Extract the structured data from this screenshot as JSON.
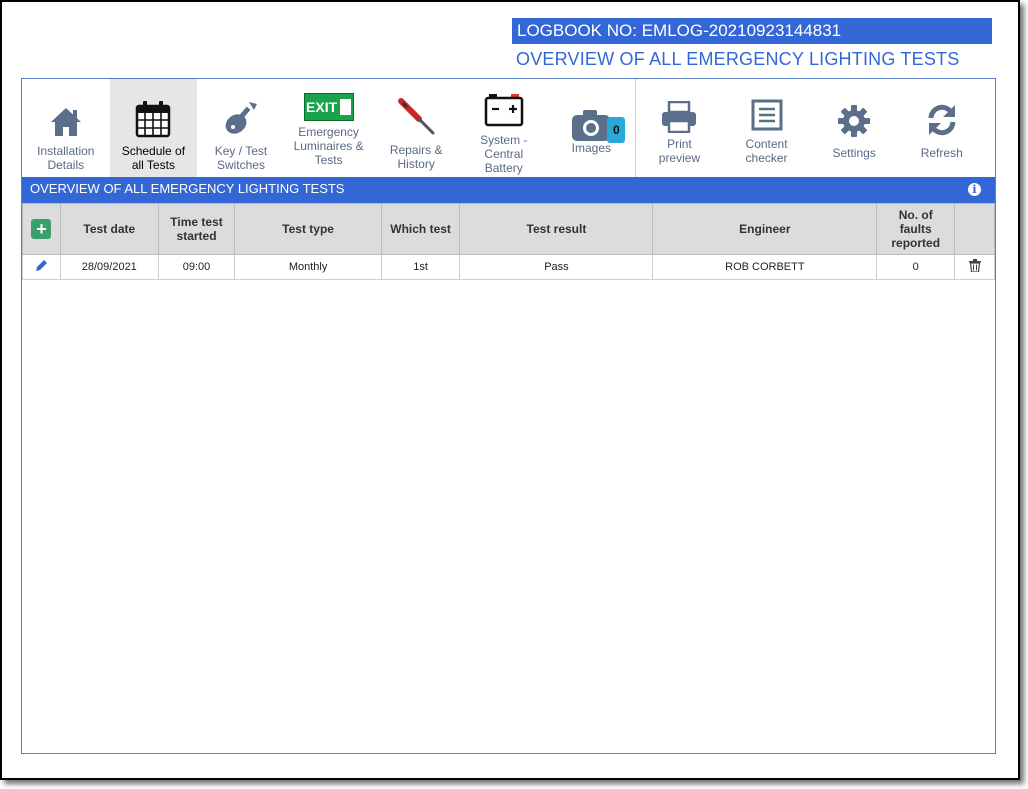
{
  "header": {
    "logbook_label": "LOGBOOK NO: EMLOG-20210923144831",
    "page_title": "OVERVIEW OF ALL EMERGENCY LIGHTING TESTS"
  },
  "toolbar": {
    "items": [
      {
        "label": "Installation\nDetails",
        "icon": "house-icon"
      },
      {
        "label": "Schedule of\nall Tests",
        "icon": "calendar-icon"
      },
      {
        "label": "Key / Test\nSwitches",
        "icon": "key-switch-icon"
      },
      {
        "label": "Emergency\nLuminaires &\nTests",
        "icon": "exit-sign-icon",
        "icon_text": "EXIT"
      },
      {
        "label": "Repairs &\nHistory",
        "icon": "screwdriver-icon"
      },
      {
        "label": "System -\nCentral\nBattery",
        "icon": "battery-icon"
      },
      {
        "label": "Images",
        "icon": "camera-icon",
        "badge": "0"
      },
      {
        "label": "Print\npreview",
        "icon": "printer-icon"
      },
      {
        "label": "Content\nchecker",
        "icon": "checklist-icon"
      },
      {
        "label": "Settings",
        "icon": "gear-icon"
      },
      {
        "label": "Refresh",
        "icon": "refresh-icon"
      }
    ],
    "active_index": 1
  },
  "section": {
    "title": "OVERVIEW OF ALL EMERGENCY LIGHTING TESTS",
    "info_icon": "i"
  },
  "table": {
    "add_icon": "+",
    "columns": [
      "Test date",
      "Time test\nstarted",
      "Test type",
      "Which test",
      "Test result",
      "Engineer",
      "No. of\nfaults\nreported"
    ],
    "rows": [
      {
        "test_date": "28/09/2021",
        "time_started": "09:00",
        "test_type": "Monthly",
        "which_test": "1st",
        "result": "Pass",
        "engineer": "ROB CORBETT",
        "faults": "0"
      }
    ]
  },
  "colors": {
    "brand_blue": "#3367d6",
    "add_green": "#3aa06a",
    "icon_slate": "#5b6f8a",
    "exit_green": "#1aa34a",
    "battery_red": "#e53935",
    "badge_teal": "#29a9d6"
  }
}
